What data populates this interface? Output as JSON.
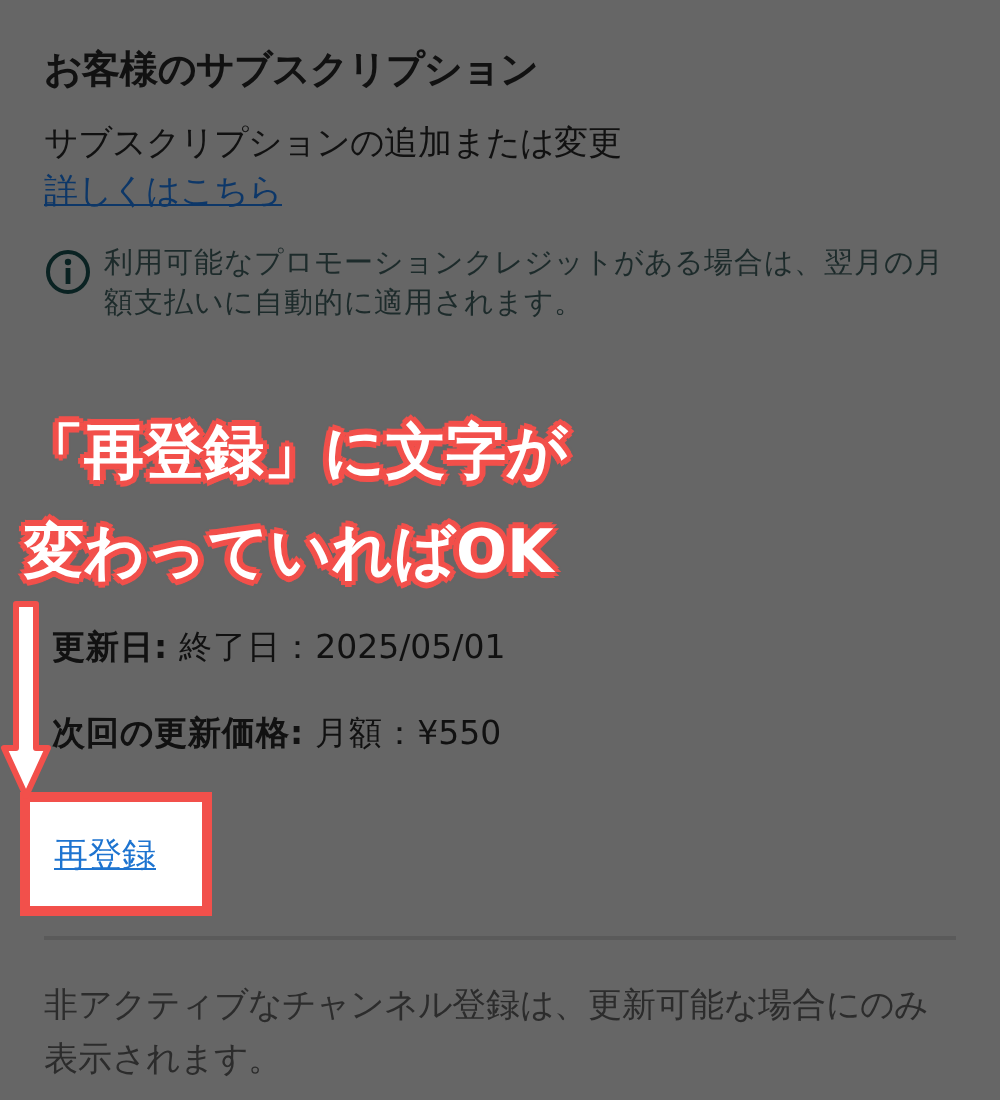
{
  "title": "お客様のサブスクリプション",
  "description": "サブスクリプションの追加または変更",
  "learn_more_link": "詳しくはこちら",
  "info_note": "利用可能なプロモーションクレジットがある場合は、翌月の月額支払いに自動的に適用されます。",
  "details": [
    {
      "label": "更新日:",
      "value": "終了日：2025/05/01"
    },
    {
      "label": "次回の更新価格:",
      "value": "月額：¥550"
    }
  ],
  "resubscribe_link": "再登録",
  "footer_note": "非アクティブなチャンネル登録は、更新可能な場合にのみ表示されます。",
  "annotation": {
    "lines": [
      "「再登録」に文字が",
      "変わっていればOK"
    ]
  }
}
